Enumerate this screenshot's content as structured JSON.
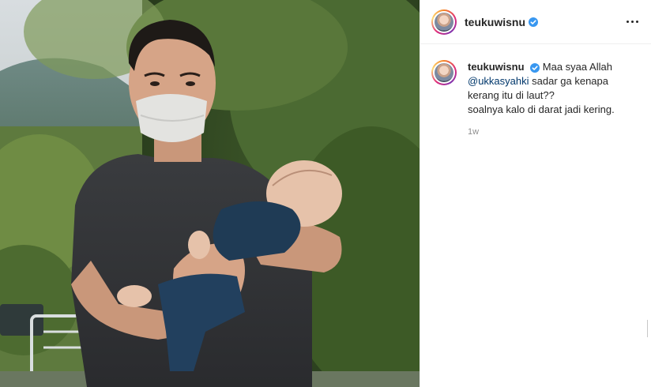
{
  "post": {
    "username": "teukuwisnu",
    "verified": true,
    "more_icon": "more-horizontal-icon"
  },
  "caption": {
    "username": "teukuwisnu",
    "text_before": "Maa syaa Allah",
    "mention": "@ukkasyahki",
    "line1_rest": "sadar ga kenapa kerang",
    "line2": "itu di laut??",
    "line3": "soalnya kalo di darat jadi kering.",
    "time": "1w"
  },
  "colors": {
    "verified": "#3897f0",
    "mention": "#00376b",
    "muted": "#8e8e8e"
  }
}
